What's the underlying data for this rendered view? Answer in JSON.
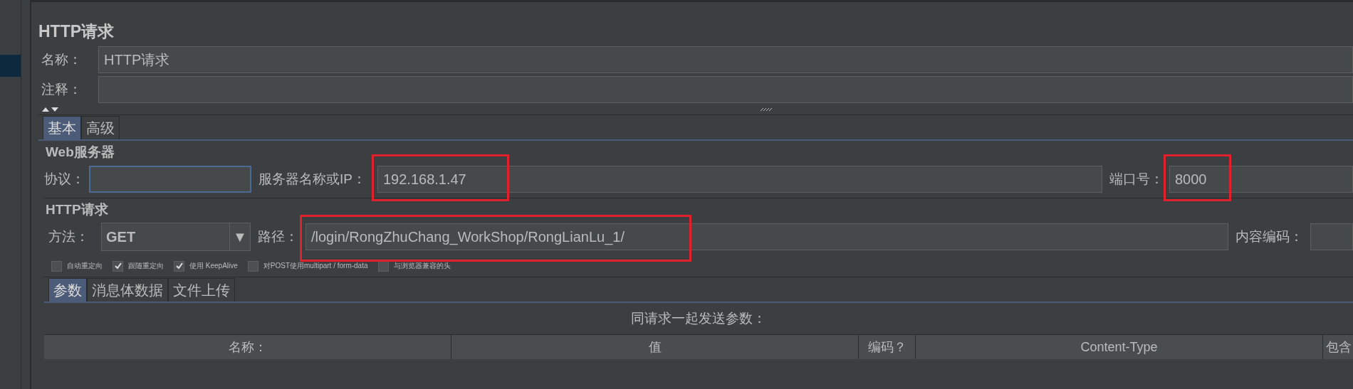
{
  "window": {
    "title": "HTTP请求"
  },
  "name_field": {
    "label": "名称：",
    "value": "HTTP请求"
  },
  "comment_field": {
    "label": "注释："
  },
  "tabs": [
    {
      "label": "基本",
      "selected": true
    },
    {
      "label": "高级",
      "selected": false
    }
  ],
  "web_server": {
    "title": "Web服务器",
    "protocol": {
      "label": "协议：",
      "focused": true,
      "highlighted": false
    },
    "server": {
      "label": "服务器名称或IP：",
      "value": "192.168.1.47",
      "highlighted": true
    },
    "port": {
      "label": "端口号：",
      "value": "8000",
      "highlighted": true
    }
  },
  "http_request": {
    "title": "HTTP请求",
    "method": {
      "label": "方法：",
      "value": "GET",
      "arrow": "▼"
    },
    "path": {
      "label": "路径：",
      "value": "/login/RongZhuChang_WorkShop/RongLianLu_1/",
      "highlighted": true
    },
    "encoding": {
      "label": "内容编码："
    }
  },
  "options": [
    {
      "label": "自动重定向",
      "checked": false
    },
    {
      "label": "跟随重定向",
      "checked": true
    },
    {
      "label": "使用 KeepAlive",
      "checked": true
    },
    {
      "label": "对POST使用multipart / form-data",
      "checked": false
    },
    {
      "label": "与浏览器兼容的头",
      "checked": false
    }
  ],
  "sub_tabs": [
    {
      "label": "参数",
      "selected": true
    },
    {
      "label": "消息体数据",
      "selected": false
    },
    {
      "label": "文件上传",
      "selected": false
    }
  ],
  "params_title": "同请求一起发送参数：",
  "table": {
    "columns": [
      "名称：",
      "值",
      "编码？",
      "Content-Type",
      "包含"
    ]
  }
}
